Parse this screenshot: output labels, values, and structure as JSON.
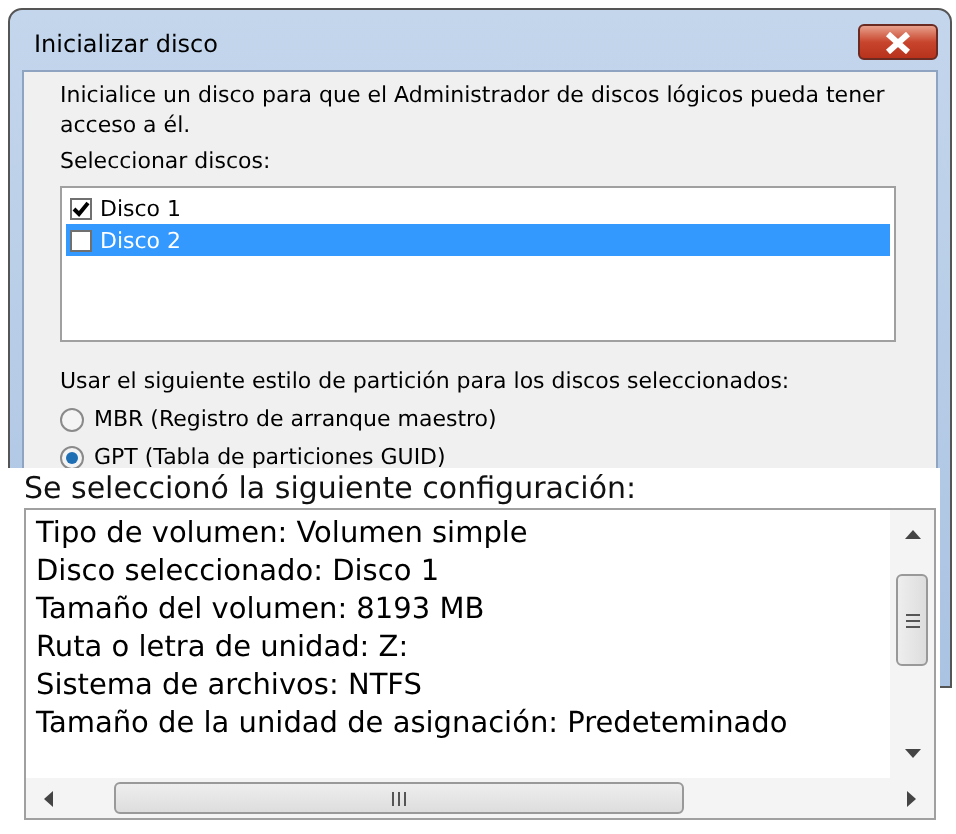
{
  "window": {
    "title": "Inicializar disco"
  },
  "intro": "Inicialice un disco para que el Administrador de discos lógicos pueda tener acceso a él.",
  "disks_label": "Seleccionar discos:",
  "disks": [
    {
      "label": "Disco 1",
      "checked": true,
      "selected": false
    },
    {
      "label": "Disco 2",
      "checked": false,
      "selected": true
    }
  ],
  "partition_label": "Usar el siguiente estilo de partición para los discos seleccionados:",
  "partition_styles": [
    {
      "label": "MBR (Registro de arranque maestro)",
      "selected": false
    },
    {
      "label": "GPT (Tabla de particiones GUID)",
      "selected": true
    }
  ],
  "summary": {
    "heading": "Se seleccionó la siguiente configuración:",
    "lines": [
      "Tipo de volumen: Volumen simple",
      "Disco seleccionado: Disco 1",
      "Tamaño del volumen: 8193 MB",
      "Ruta o letra de unidad: Z:",
      "Sistema de archivos: NTFS",
      "Tamaño de la unidad de asignación: Predeteminado"
    ]
  }
}
